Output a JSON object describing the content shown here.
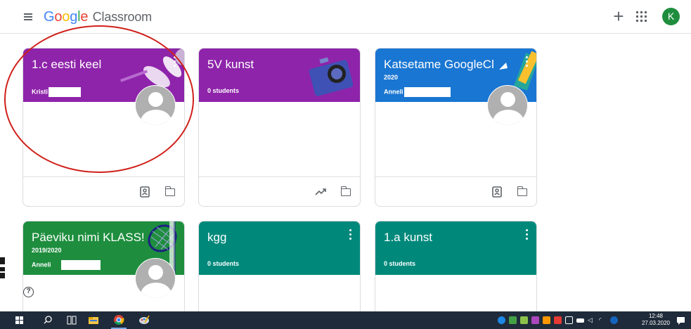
{
  "app": {
    "logo_google": "Google",
    "logo_product": "Classroom",
    "plus": "+",
    "avatar_letter": "K",
    "accent_colors": {
      "google_blue": "#4285f4",
      "google_red": "#ea4335",
      "google_yellow": "#fbbc05",
      "google_green": "#34a853",
      "avatar_green": "#1e8e3e",
      "purple": "#8e24aa",
      "blue": "#1976d2",
      "green": "#1e8e3e",
      "teal": "#00897b",
      "annotation_red": "#d0201a"
    }
  },
  "cards": [
    {
      "title": "1.c eesti keel",
      "section": "",
      "owner": "Kristi",
      "students": "",
      "color": "#8e24aa",
      "has_avatar": true,
      "footer_icons": [
        "gradebook-icon",
        "folder-icon"
      ]
    },
    {
      "title": "5V kunst",
      "section": "",
      "owner": "",
      "students": "0 students",
      "color": "#8e24aa",
      "has_avatar": false,
      "footer_icons": [
        "trending-icon",
        "folder-icon"
      ]
    },
    {
      "title": "Katsetame GoogleCl",
      "section": "2020",
      "owner": "Anneli",
      "students": "",
      "color": "#1976d2",
      "has_avatar": true,
      "footer_icons": [
        "gradebook-icon",
        "folder-icon"
      ]
    },
    {
      "title": "Päeviku nimi KLASS!",
      "section": "2019/2020",
      "owner": "Anneli",
      "students": "",
      "color": "#1e8e3e",
      "has_avatar": true,
      "footer_icons": []
    },
    {
      "title": "kgg",
      "section": "",
      "owner": "",
      "students": "0 students",
      "color": "#00897b",
      "has_avatar": false,
      "footer_icons": []
    },
    {
      "title": "1.a kunst",
      "section": "",
      "owner": "",
      "students": "0 students",
      "color": "#00897b",
      "has_avatar": false,
      "footer_icons": []
    }
  ],
  "help": "?",
  "taskbar": {
    "time": "12:48",
    "date": "27.03.2020"
  }
}
